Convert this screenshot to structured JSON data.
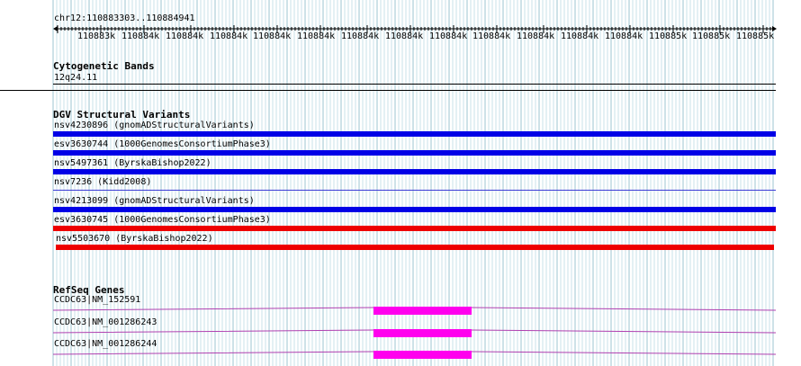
{
  "ruler": {
    "location": "chr12:110883303..110884941",
    "ticks": [
      "110883k",
      "110884k",
      "110884k",
      "110884k",
      "110884k",
      "110884k",
      "110884k",
      "110884k",
      "110884k",
      "110884k",
      "110884k",
      "110884k",
      "110884k",
      "110885k",
      "110885k",
      "110885k",
      "110885k"
    ]
  },
  "cytobands": {
    "title": "Cytogenetic Bands",
    "band": "12q24.11"
  },
  "dgv": {
    "title": "DGV Structural Variants",
    "variants": [
      {
        "label": "nsv4230896 (gnomADStructuralVariants)",
        "color": "#0000e6"
      },
      {
        "label": "esv3630744 (1000GenomesConsortiumPhase3)",
        "color": "#0000e6"
      },
      {
        "label": "nsv5497361 (ByrskaBishop2022)",
        "color": "#0000e6"
      },
      {
        "label": "nsv7236 (Kidd2008)",
        "color": "#0000e6"
      },
      {
        "label": "nsv4213099 (gnomADStructuralVariants)",
        "color": "#0000e6"
      },
      {
        "label": "esv3630745 (1000GenomesConsortiumPhase3)",
        "color": "#ee0000"
      },
      {
        "label": "nsv5503670 (ByrskaBishop2022)",
        "color": "#ee0000"
      }
    ]
  },
  "refseq": {
    "title": "RefSeq Genes",
    "genes": [
      {
        "label": "CCDC63|NM_152591",
        "color": "#ff00ee"
      },
      {
        "label": "CCDC63|NM_001286243",
        "color": "#ff00ee"
      },
      {
        "label": "CCDC63|NM_001286244",
        "color": "#ff00ee"
      }
    ]
  }
}
